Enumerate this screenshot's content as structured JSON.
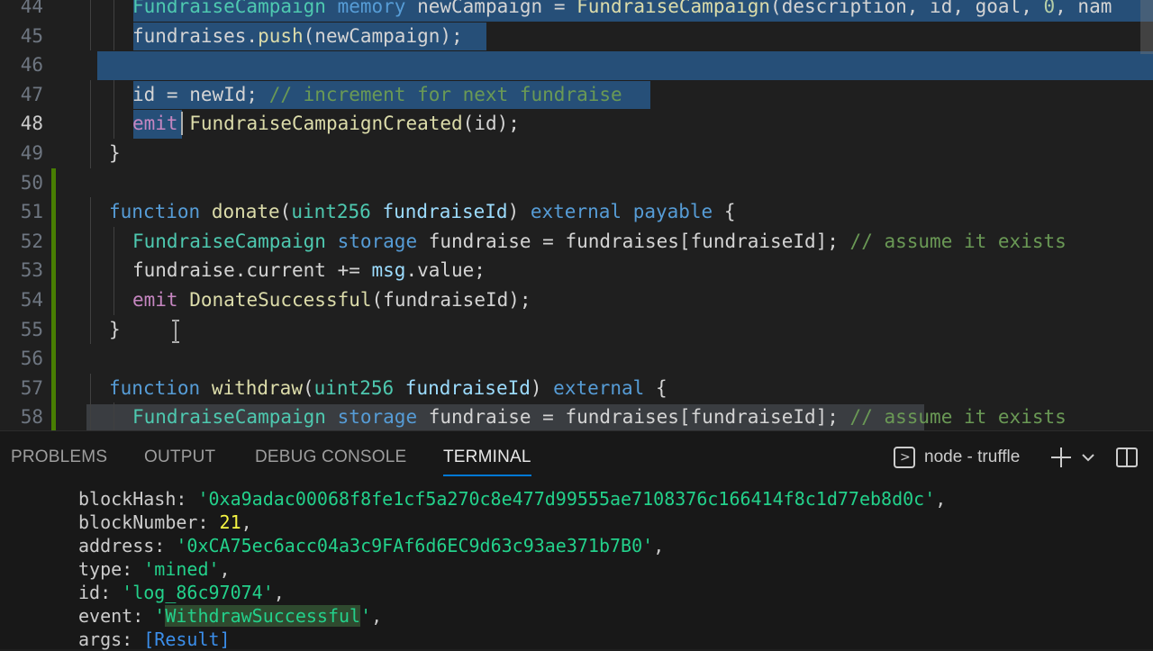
{
  "editor": {
    "lines": [
      {
        "num": "44",
        "tokens": [
          [
            "ty",
            "FundraiseCampaign"
          ],
          [
            "pl",
            " "
          ],
          [
            "kw",
            "memory"
          ],
          [
            "pl",
            " newCampaign = "
          ],
          [
            "fn",
            "FundraiseCampaign"
          ],
          [
            "pl",
            "(description, id, goal, "
          ],
          [
            "num",
            "0"
          ],
          [
            "pl",
            ", nam"
          ]
        ]
      },
      {
        "num": "45",
        "tokens": [
          [
            "pl",
            "fundraises."
          ],
          [
            "fn",
            "push"
          ],
          [
            "pl",
            "(newCampaign);"
          ]
        ]
      },
      {
        "num": "46",
        "tokens": []
      },
      {
        "num": "47",
        "tokens": [
          [
            "pl",
            "id = newId; "
          ],
          [
            "cm",
            "// increment for next fundraise"
          ]
        ]
      },
      {
        "num": "48",
        "tokens": [
          [
            "ctl",
            "emit"
          ],
          [
            "pl",
            " "
          ],
          [
            "fn",
            "FundraiseCampaignCreated"
          ],
          [
            "pl",
            "(id);"
          ]
        ]
      },
      {
        "num": "49",
        "tokens": [
          [
            "pl",
            "}"
          ]
        ]
      },
      {
        "num": "50",
        "tokens": []
      },
      {
        "num": "51",
        "tokens": [
          [
            "kw",
            "function"
          ],
          [
            "pl",
            " "
          ],
          [
            "fn",
            "donate"
          ],
          [
            "pl",
            "("
          ],
          [
            "ty",
            "uint256"
          ],
          [
            "pl",
            " "
          ],
          [
            "var",
            "fundraiseId"
          ],
          [
            "pl",
            ") "
          ],
          [
            "kw",
            "external"
          ],
          [
            "pl",
            " "
          ],
          [
            "kw",
            "payable"
          ],
          [
            "pl",
            " {"
          ]
        ]
      },
      {
        "num": "52",
        "tokens": [
          [
            "ty",
            "FundraiseCampaign"
          ],
          [
            "pl",
            " "
          ],
          [
            "kw",
            "storage"
          ],
          [
            "pl",
            " fundraise = fundraises[fundraiseId]; "
          ],
          [
            "cm",
            "// assume it exists"
          ]
        ]
      },
      {
        "num": "53",
        "tokens": [
          [
            "pl",
            "fundraise.current += "
          ],
          [
            "var",
            "msg"
          ],
          [
            "pl",
            ".value;"
          ]
        ]
      },
      {
        "num": "54",
        "tokens": [
          [
            "ctl",
            "emit"
          ],
          [
            "pl",
            " "
          ],
          [
            "fn",
            "DonateSuccessful"
          ],
          [
            "pl",
            "(fundraiseId);"
          ]
        ]
      },
      {
        "num": "55",
        "tokens": [
          [
            "pl",
            "}"
          ]
        ]
      },
      {
        "num": "56",
        "tokens": []
      },
      {
        "num": "57",
        "tokens": [
          [
            "kw",
            "function"
          ],
          [
            "pl",
            " "
          ],
          [
            "fn",
            "withdraw"
          ],
          [
            "pl",
            "("
          ],
          [
            "ty",
            "uint256"
          ],
          [
            "pl",
            " "
          ],
          [
            "var",
            "fundraiseId"
          ],
          [
            "pl",
            ") "
          ],
          [
            "kw",
            "external"
          ],
          [
            "pl",
            " {"
          ]
        ]
      },
      {
        "num": "58",
        "tokens": [
          [
            "ty",
            "FundraiseCampaign"
          ],
          [
            "pl",
            " "
          ],
          [
            "kw",
            "storage"
          ],
          [
            "pl",
            " fundraise = fundraises[fundraiseId]; "
          ],
          [
            "cm",
            "// assume it exists"
          ]
        ]
      }
    ]
  },
  "panel": {
    "tabs": [
      {
        "label": "PROBLEMS"
      },
      {
        "label": "OUTPUT"
      },
      {
        "label": "DEBUG CONSOLE"
      },
      {
        "label": "TERMINAL",
        "active": true
      }
    ],
    "terminal_name": "node - truffle",
    "icons": {
      "shell": "terminal-icon",
      "add": "plus-icon",
      "menu": "chevron-down-icon",
      "split": "split-panel-icon"
    }
  },
  "terminal": {
    "lines": [
      [
        [
          "key",
          "blockHash: "
        ],
        [
          "str",
          "'0xa9adac00068f8fe1cf5a270c8e477d99555ae7108376c166414f8c1d77eb8d0c'"
        ],
        [
          "key",
          ","
        ]
      ],
      [
        [
          "key",
          "blockNumber: "
        ],
        [
          "num",
          "21"
        ],
        [
          "key",
          ","
        ]
      ],
      [
        [
          "key",
          "address: "
        ],
        [
          "str",
          "'0xCA75ec6acc04a3c9FAf6d6EC9d63c93ae371b7B0'"
        ],
        [
          "key",
          ","
        ]
      ],
      [
        [
          "key",
          "type: "
        ],
        [
          "str",
          "'mined'"
        ],
        [
          "key",
          ","
        ]
      ],
      [
        [
          "key",
          "id: "
        ],
        [
          "str",
          "'log_86c97074'"
        ],
        [
          "key",
          ","
        ]
      ],
      [
        [
          "key",
          "event: "
        ],
        [
          "str",
          "'"
        ],
        [
          "strhl",
          "WithdrawSuccessful"
        ],
        [
          "str",
          "'"
        ],
        [
          "key",
          ","
        ]
      ],
      [
        [
          "key",
          "args: "
        ],
        [
          "ref",
          "[Result]"
        ]
      ]
    ]
  },
  "colors": {
    "accent": "#0078d4",
    "modified": "#487e02",
    "selection": "#264f78"
  }
}
